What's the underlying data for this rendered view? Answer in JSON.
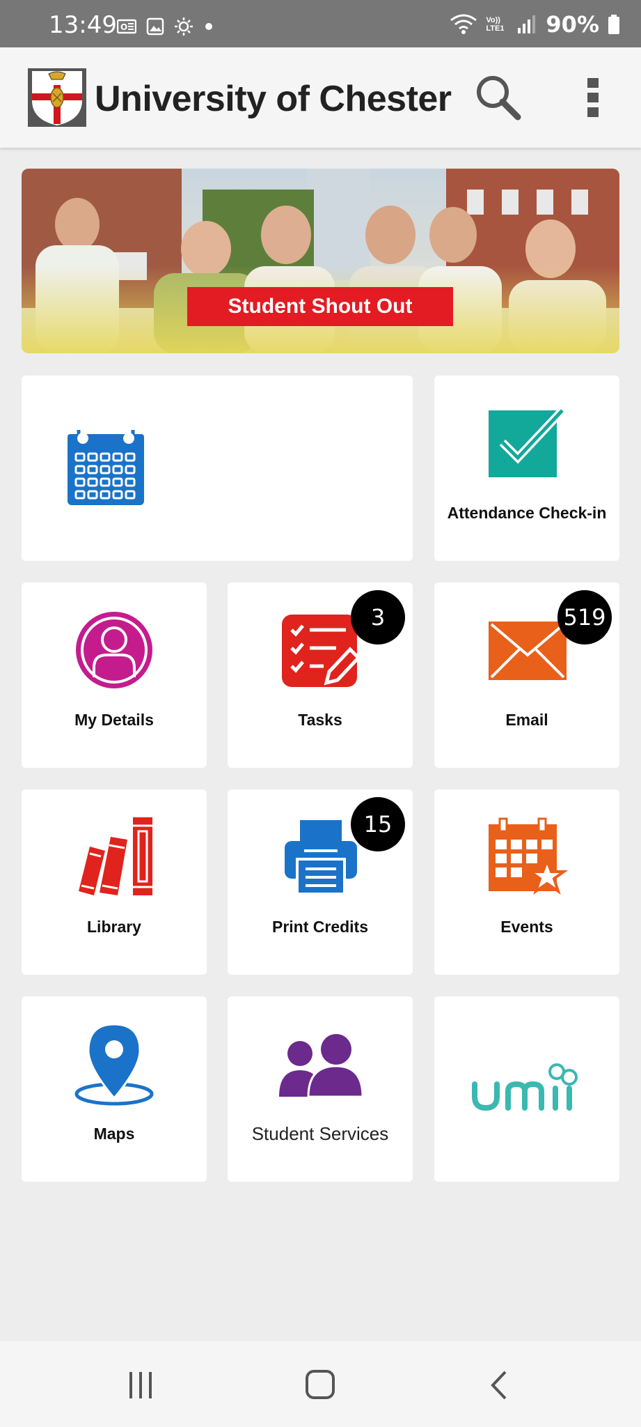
{
  "status_bar": {
    "time": "13:49",
    "battery": "90%",
    "network": "Vo)) LTE1"
  },
  "app_bar": {
    "title": "University of Chester"
  },
  "banner": {
    "label": "Student Shout Out"
  },
  "tiles": [
    {
      "id": "calendar",
      "label": "",
      "icon": "calendar-icon",
      "color": "#1a73c8"
    },
    {
      "id": "attendance",
      "label": "Attendance Check-in",
      "icon": "checkbox-icon",
      "color": "#12a89a"
    },
    {
      "id": "my-details",
      "label": "My Details",
      "icon": "person-icon",
      "color": "#c41c8d"
    },
    {
      "id": "tasks",
      "label": "Tasks",
      "icon": "checklist-icon",
      "color": "#e0231c",
      "badge": "3"
    },
    {
      "id": "email",
      "label": "Email",
      "icon": "envelope-icon",
      "color": "#e8601a",
      "badge": "519"
    },
    {
      "id": "library",
      "label": "Library",
      "icon": "books-icon",
      "color": "#e0231c"
    },
    {
      "id": "print-credits",
      "label": "Print Credits",
      "icon": "printer-icon",
      "color": "#1a73c8",
      "badge": "15"
    },
    {
      "id": "events",
      "label": "Events",
      "icon": "event-calendar-icon",
      "color": "#e8601a"
    },
    {
      "id": "maps",
      "label": "Maps",
      "icon": "map-pin-icon",
      "color": "#1a73c8"
    },
    {
      "id": "student-services",
      "label": "Student Services",
      "icon": "people-icon",
      "color": "#6b2a8c"
    },
    {
      "id": "umii",
      "label": "umii",
      "icon": "umii-logo",
      "color": "#3bb8b0"
    }
  ],
  "nav": {
    "recents": "recents-icon",
    "home": "home-icon",
    "back": "back-icon"
  }
}
